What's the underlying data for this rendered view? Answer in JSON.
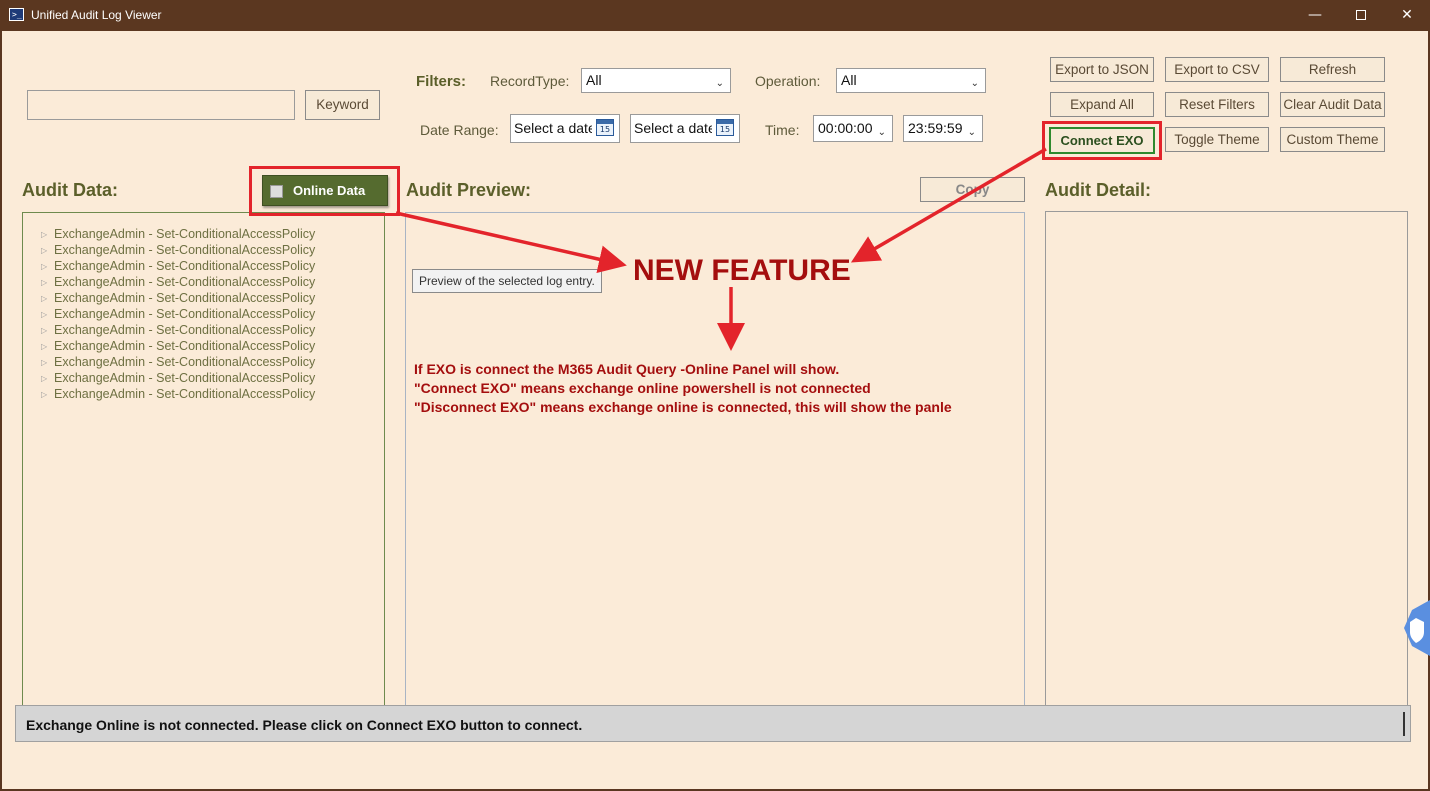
{
  "window": {
    "title": "Unified Audit Log Viewer",
    "minimize": "—",
    "close": "✕"
  },
  "search": {
    "value": "",
    "keyword_button": "Keyword"
  },
  "filters": {
    "label": "Filters:",
    "record_type_label": "RecordType:",
    "record_type_value": "All",
    "operation_label": "Operation:",
    "operation_value": "All",
    "date_range_label": "Date Range:",
    "date_from": "Select a date",
    "date_to": "Select a date",
    "calendar_day": "15",
    "time_label": "Time:",
    "time_from": "00:00:00",
    "time_to": "23:59:59"
  },
  "toolbar": {
    "export_json": "Export to JSON",
    "export_csv": "Export to CSV",
    "refresh": "Refresh",
    "expand_all": "Expand All",
    "reset_filters": "Reset Filters",
    "clear_audit_data": "Clear Audit Data",
    "connect_exo": "Connect EXO",
    "toggle_theme": "Toggle Theme",
    "custom_theme": "Custom Theme"
  },
  "audit_data": {
    "title": "Audit Data:",
    "online_toggle": "Online Data",
    "items": [
      "ExchangeAdmin - Set-ConditionalAccessPolicy",
      "ExchangeAdmin - Set-ConditionalAccessPolicy",
      "ExchangeAdmin - Set-ConditionalAccessPolicy",
      "ExchangeAdmin - Set-ConditionalAccessPolicy",
      "ExchangeAdmin - Set-ConditionalAccessPolicy",
      "ExchangeAdmin - Set-ConditionalAccessPolicy",
      "ExchangeAdmin - Set-ConditionalAccessPolicy",
      "ExchangeAdmin - Set-ConditionalAccessPolicy",
      "ExchangeAdmin - Set-ConditionalAccessPolicy",
      "ExchangeAdmin - Set-ConditionalAccessPolicy",
      "ExchangeAdmin - Set-ConditionalAccessPolicy"
    ]
  },
  "audit_preview": {
    "title": "Audit Preview:",
    "copy_button": "Copy",
    "tooltip": "Preview of the selected log entry."
  },
  "audit_detail": {
    "title": "Audit Detail:"
  },
  "annotation": {
    "headline": "NEW FEATURE",
    "lines": [
      "If EXO is connect the M365 Audit Query -Online Panel will show.",
      "\"Connect EXO\" means exchange online powershell is not connected",
      "\"Disconnect EXO\" means exchange online is connected, this will show the panle"
    ],
    "color": "#a40e0e",
    "highlight_color": "#e3242b"
  },
  "status": {
    "message": "Exchange Online is not connected. Please click on Connect EXO button to connect."
  }
}
